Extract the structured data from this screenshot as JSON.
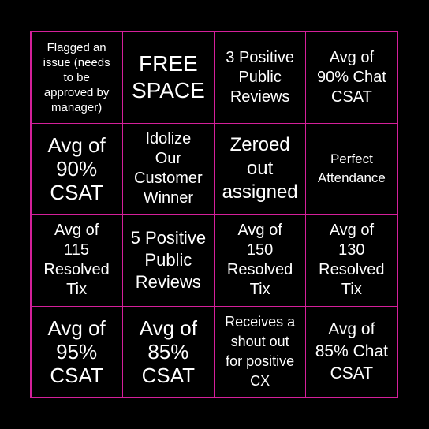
{
  "colors": {
    "background": "#000000",
    "grid_line": "#d4209a",
    "text": "#ffffff"
  },
  "cells": [
    "Flagged an\nissue (needs\nto be\napproved by\nmanager)",
    "FREE\nSPACE",
    "3 Positive\nPublic\nReviews",
    "Avg of\n90% Chat\nCSAT",
    "Avg of\n90%\nCSAT",
    "Idolize\nOur\nCustomer\nWinner",
    "Zeroed\nout\nassigned",
    "Perfect\nAttendance",
    "Avg of\n115\nResolved\nTix",
    "5 Positive\nPublic\nReviews",
    "Avg of\n150\nResolved\nTix",
    "Avg of\n130\nResolved\nTix",
    "Avg of\n95%\nCSAT",
    "Avg of\n85%\nCSAT",
    "Receives a\nshout out\nfor positive\nCX",
    "Avg of\n85% Chat\nCSAT"
  ]
}
